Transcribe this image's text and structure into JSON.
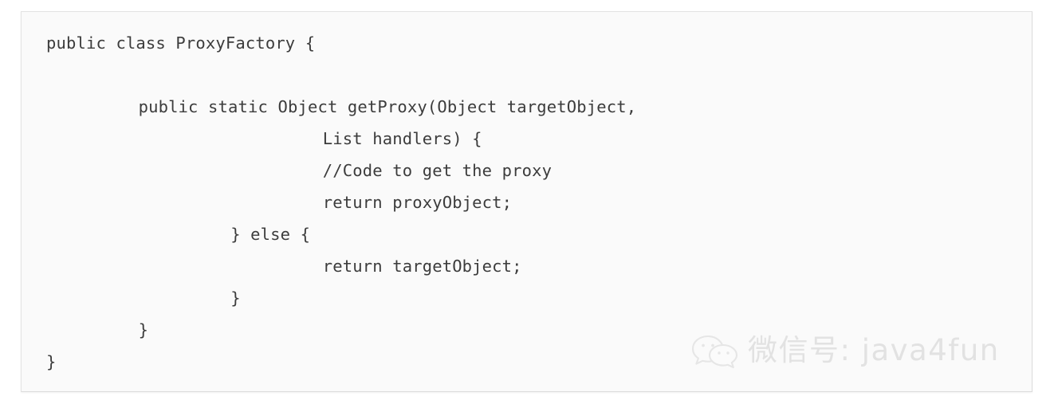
{
  "card": {
    "language": "java",
    "background_color": "#fafafa",
    "border_color": "#e3e3e3",
    "text_color": "#3c3c3c"
  },
  "code": {
    "lines": [
      {
        "indent": 0,
        "text": "public class ProxyFactory {"
      },
      {
        "indent": 0,
        "text": ""
      },
      {
        "indent": 8,
        "text": "public static Object getProxy(Object targetObject,"
      },
      {
        "indent": 24,
        "text": "List handlers) {"
      },
      {
        "indent": 24,
        "text": "//Code to get the proxy"
      },
      {
        "indent": 24,
        "text": "return proxyObject;"
      },
      {
        "indent": 16,
        "text": "} else {"
      },
      {
        "indent": 24,
        "text": "return targetObject;"
      },
      {
        "indent": 16,
        "text": "}"
      },
      {
        "indent": 8,
        "text": "}"
      },
      {
        "indent": 0,
        "text": "}"
      }
    ]
  },
  "watermark": {
    "icon": "wechat-logo-icon",
    "text": "微信号: java4fun",
    "color": "#e2e2e2"
  }
}
